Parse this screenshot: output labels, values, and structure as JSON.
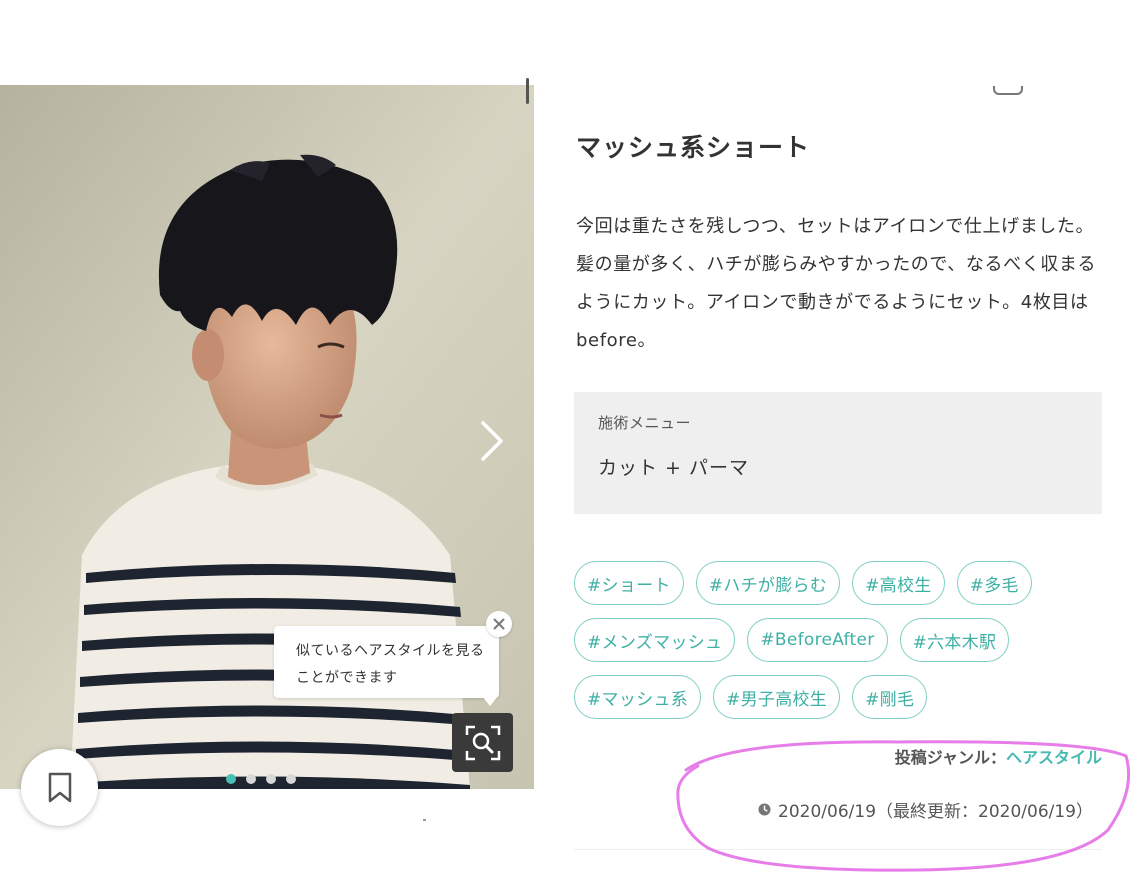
{
  "post": {
    "title": "マッシュ系ショート",
    "description": "今回は重たさを残しつつ、セットはアイロンで仕上げました。髪の量が多く、ハチが膨らみやすかったので、なるべく収まるようにカット。アイロンで動きがでるようにセット。4枚目はbefore。",
    "menu_label": "施術メニュー",
    "menu_value": "カット + パーマ",
    "tags": [
      "#ショート",
      "#ハチが膨らむ",
      "#高校生",
      "#多毛",
      "#メンズマッシュ",
      "#BeforeAfter",
      "#六本木駅",
      "#マッシュ系",
      "#男子高校生",
      "#剛毛"
    ],
    "genre_label": "投稿ジャンル：",
    "genre_value": "ヘアスタイル",
    "date_text": "2020/06/19（最終更新：2020/06/19）"
  },
  "carousel": {
    "tooltip": "似ているヘアスタイルを見ることができます",
    "page_count": 4,
    "active_index": 0
  },
  "icons": {
    "next": "chevron-right-icon",
    "close": "close-icon",
    "search": "image-search-icon",
    "bookmark": "bookmark-icon",
    "clock": "clock-icon"
  },
  "colors": {
    "accent": "#48c0b5",
    "tag_border": "#7fcfc5",
    "menu_background": "#efefef",
    "annotation": "#e77de8"
  }
}
